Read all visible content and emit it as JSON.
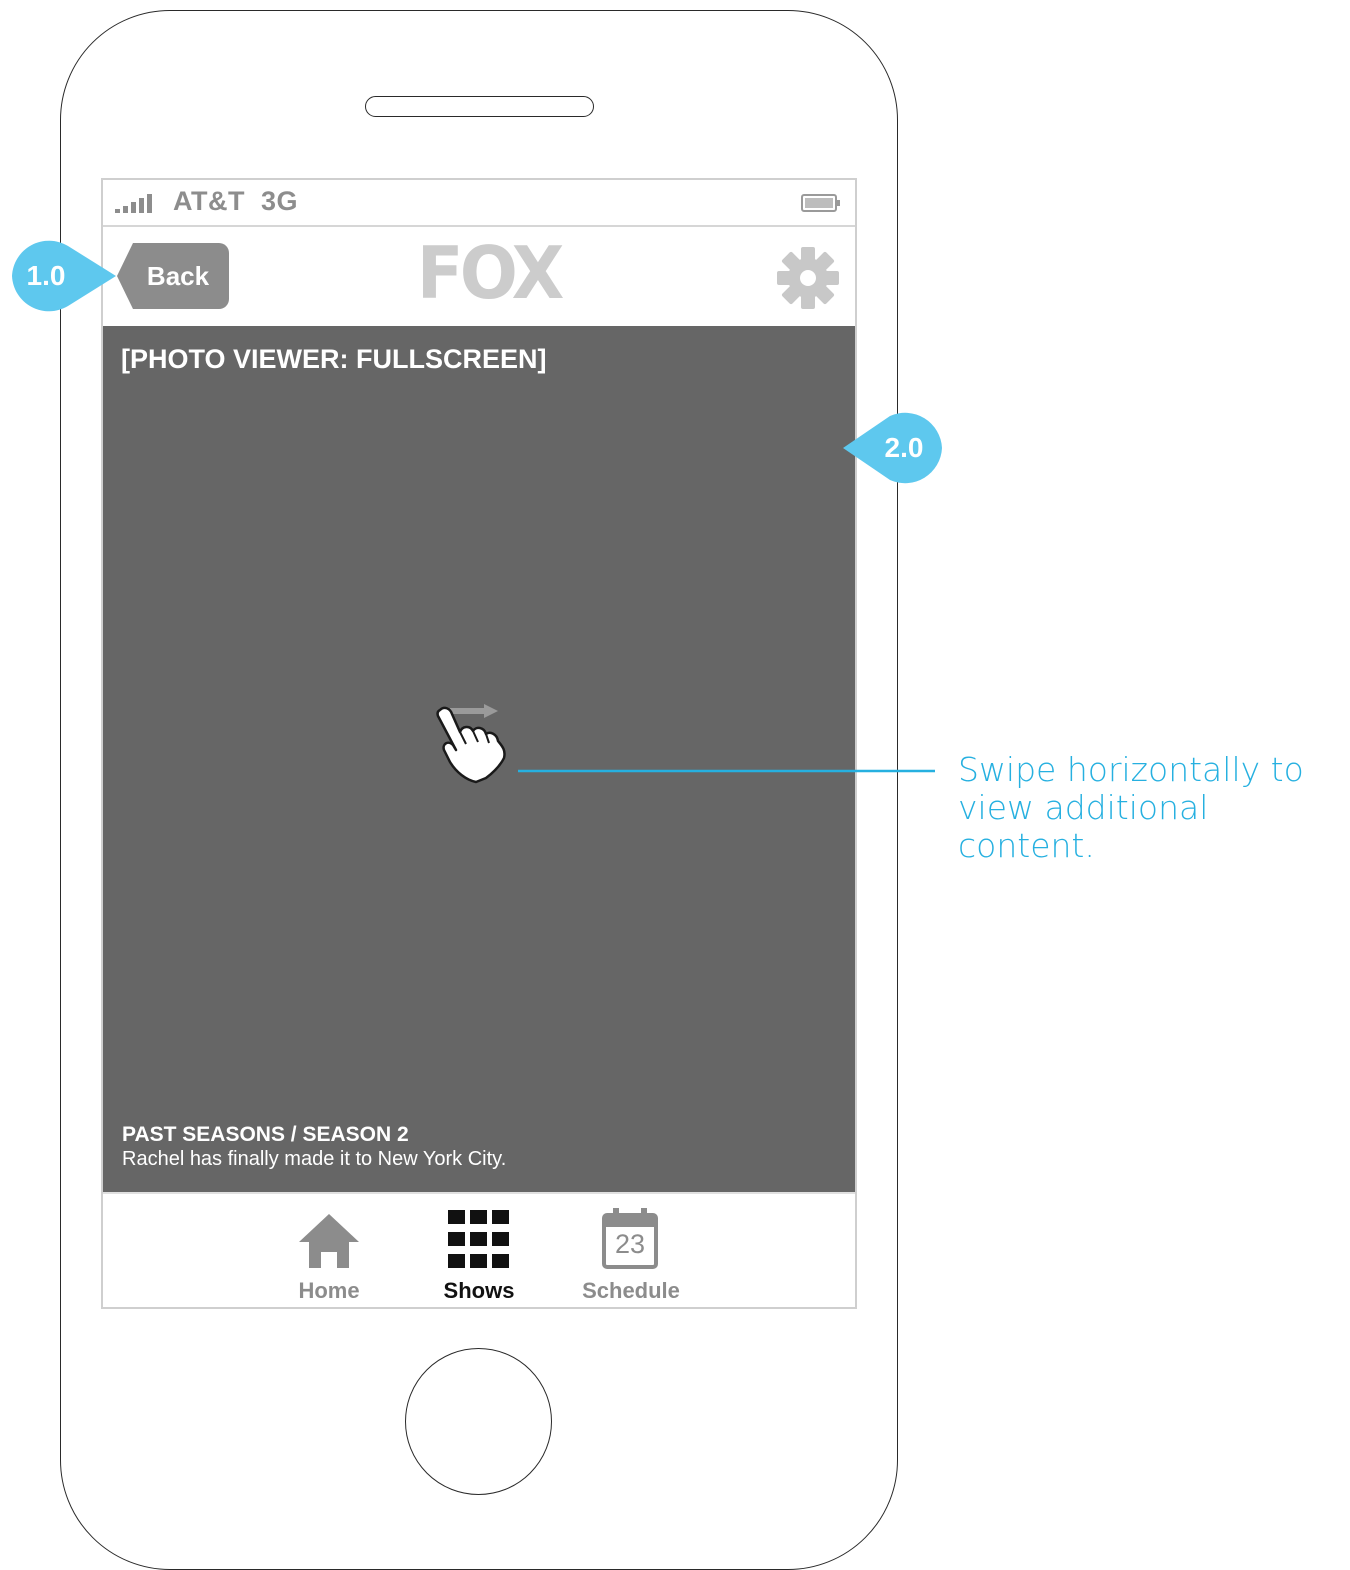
{
  "status_bar": {
    "carrier": "AT&T",
    "network": "3G"
  },
  "nav_bar": {
    "back_label": "Back",
    "logo_text": "FOX",
    "settings_icon": "gear-icon"
  },
  "photo_viewer": {
    "title": "[PHOTO VIEWER: FULLSCREEN]",
    "caption_title": "PAST SEASONS / SEASON 2",
    "caption_text": "Rachel has finally made it to New York City."
  },
  "tab_bar": {
    "tabs": [
      {
        "label": "Home",
        "icon": "home-icon",
        "active": false
      },
      {
        "label": "Shows",
        "icon": "grid-icon",
        "active": true
      },
      {
        "label": "Schedule",
        "icon": "calendar-icon",
        "active": false
      }
    ],
    "calendar_day": "23"
  },
  "annotations": {
    "callout_1": "1.0",
    "callout_2": "2.0",
    "swipe_note": "Swipe horizontally to view additional content."
  },
  "colors": {
    "accent": "#26b0e0",
    "callout_fill": "#5ec8ee",
    "photo_bg": "#666666",
    "inactive": "#8c8c8c",
    "active": "#111111"
  }
}
